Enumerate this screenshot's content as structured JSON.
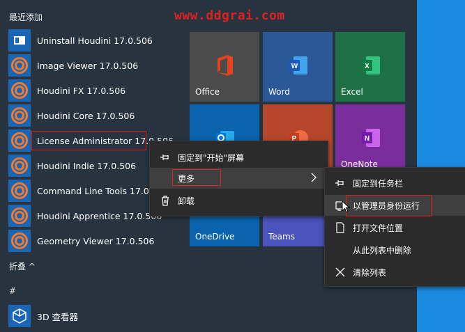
{
  "watermark": "www.ddgrai.com",
  "recent_header": "最近添加",
  "apps": [
    {
      "label": "Uninstall Houdini 17.0.506",
      "icon": "uninstall-icon"
    },
    {
      "label": "Image Viewer 17.0.506",
      "icon": "houdini-icon"
    },
    {
      "label": "Houdini FX 17.0.506",
      "icon": "houdini-icon"
    },
    {
      "label": "Houdini Core 17.0.506",
      "icon": "houdini-icon"
    },
    {
      "label": "License Administrator 17.0.506",
      "icon": "houdini-icon"
    },
    {
      "label": "Houdini Indie 17.0.506",
      "icon": "houdini-icon"
    },
    {
      "label": "Command Line Tools 17.0.506",
      "icon": "houdini-icon"
    },
    {
      "label": "Houdini Apprentice 17.0.506",
      "icon": "houdini-icon"
    },
    {
      "label": "Geometry Viewer 17.0.506",
      "icon": "houdini-icon"
    }
  ],
  "collapse_label": "折叠 ^",
  "hash_header": "#",
  "viewer3d_label": "3D 查看器",
  "tiles": {
    "office": "Office",
    "word": "Word",
    "excel": "Excel",
    "onenote": "OneNote",
    "onedrive": "OneDrive",
    "teams": "Teams"
  },
  "context_menu": {
    "pin_start": "固定到\"开始\"屏幕",
    "more": "更多",
    "uninstall": "卸载"
  },
  "sub_menu": {
    "pin_taskbar": "固定到任务栏",
    "run_as_admin": "以管理员身份运行",
    "open_location": "打开文件位置",
    "remove_from_list": "从此列表中删除",
    "clear_list": "清除列表"
  },
  "colors": {
    "start_bg": "#27343f",
    "desktop_accent": "#1a8ce0",
    "houdini_orange": "#f27a2a",
    "highlight_red": "#e02020",
    "office": "#4b4b4b",
    "word": "#2b5797",
    "excel": "#1e7145",
    "onenote": "#7b2d9c",
    "outlook": "#0a64ad",
    "powerpoint": "#b7472a"
  }
}
